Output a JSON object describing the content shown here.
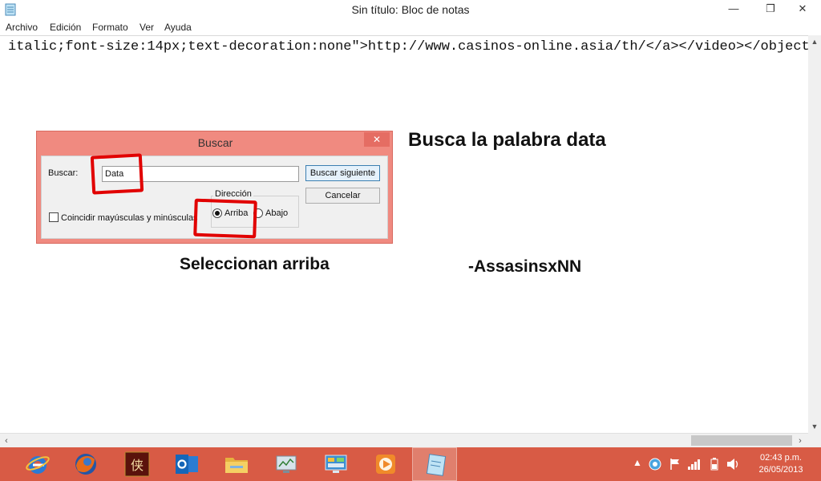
{
  "window": {
    "title": "Sin título: Bloc de notas",
    "min_glyph": "—",
    "max_glyph": "❐",
    "close_glyph": "✕"
  },
  "menu": [
    "Archivo",
    "Edición",
    "Formato",
    "Ver",
    "Ayuda"
  ],
  "editor": {
    "line": "italic;font-size:14px;text-decoration:none\">http://www.casinos-online.asia/th/</a></video></object>"
  },
  "dialog": {
    "title": "Buscar",
    "close_glyph": "✕",
    "find_label": "Buscar:",
    "find_value": "Data",
    "find_next_button": "Buscar siguiente",
    "cancel_button": "Cancelar",
    "direction_label": "Dirección",
    "up_label": "Arriba",
    "down_label": "Abajo",
    "direction_selected": "up",
    "match_case_label": "Coincidir mayúsculas y minúsculas",
    "match_case_checked": false
  },
  "annotations": {
    "heading": "Busca la palabra data",
    "caption": "Seleccionan arriba",
    "author": "-AssasinsxNN"
  },
  "taskbar": {
    "apps": [
      {
        "name": "ie-icon",
        "color": "#2a7ad5"
      },
      {
        "name": "firefox-icon",
        "color": "#e66a1a"
      },
      {
        "name": "game-icon",
        "color": "#7a1a10"
      },
      {
        "name": "outlook-icon",
        "color": "#1666b8"
      },
      {
        "name": "explorer-icon",
        "color": "#f2c14e"
      },
      {
        "name": "monitor-icon",
        "color": "#cfd8de"
      },
      {
        "name": "control-panel-icon",
        "color": "#3d8fd1"
      },
      {
        "name": "media-player-icon",
        "color": "#f08a2a"
      },
      {
        "name": "notepad-icon",
        "color": "#9fd0e8"
      }
    ],
    "active_index": 8,
    "time": "02:43 p.m.",
    "date": "26/05/2013"
  },
  "colors": {
    "taskbar": "#d85b45",
    "dialog_frame": "#f08a80",
    "marker": "#e10000"
  }
}
